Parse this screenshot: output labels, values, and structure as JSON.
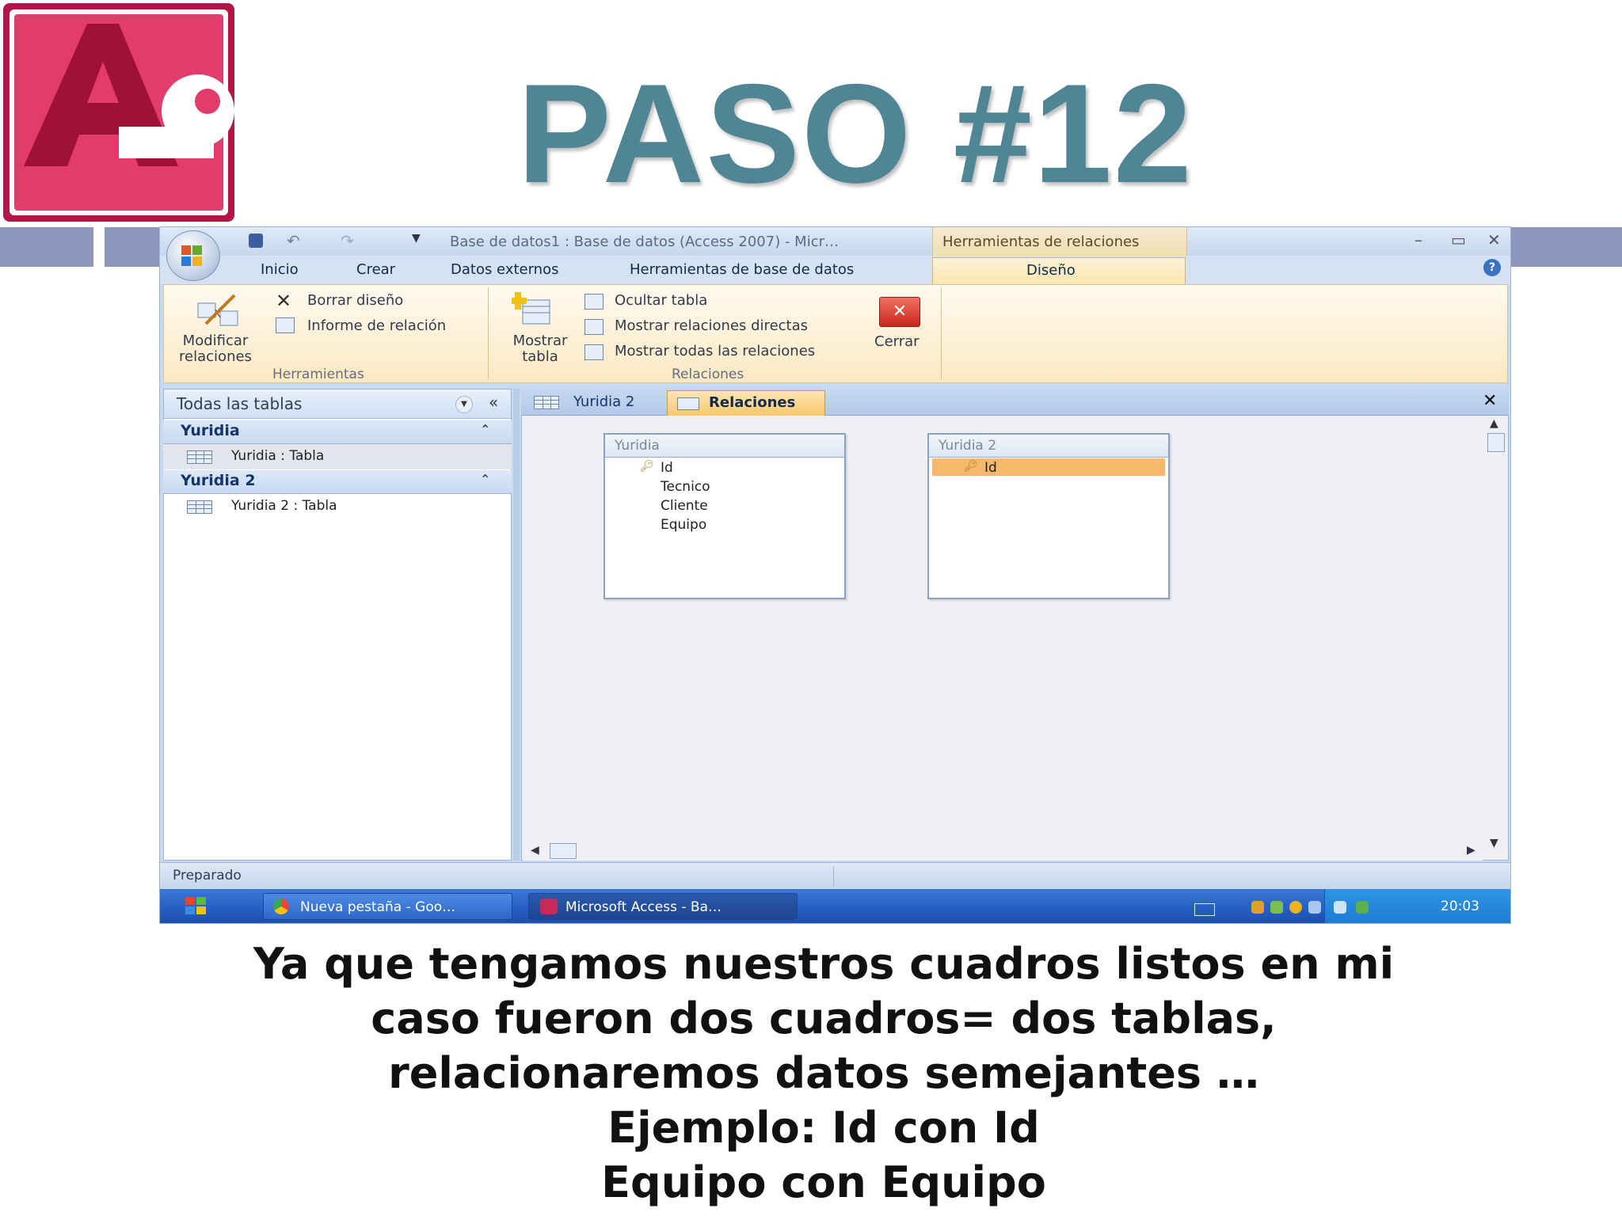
{
  "slide": {
    "title": "PASO #12",
    "caption_lines": [
      "Ya que tengamos nuestros cuadros listos en mi",
      "caso fueron dos cuadros= dos tablas,",
      "relacionaremos datos semejantes …",
      "Ejemplo: Id con Id",
      "Equipo con Equipo"
    ],
    "logo_letter": "A",
    "colors": {
      "title": "#4f8594",
      "band": "#8d97bc",
      "logo": "#a1123c"
    }
  },
  "window": {
    "title": "Base de datos1 : Base de datos (Access 2007) - Micr…",
    "context_title": "Herramientas de relaciones",
    "tabs": [
      "Inicio",
      "Crear",
      "Datos externos",
      "Herramientas de base de datos"
    ],
    "active_tab": "Diseño",
    "controls": {
      "minimize": "–",
      "maximize": "▭",
      "close": "✕",
      "help": "?"
    }
  },
  "ribbon": {
    "herramientas": {
      "label": "Herramientas",
      "modify_line1": "Modificar",
      "modify_line2": "relaciones",
      "clear_layout": "Borrar diseño",
      "report": "Informe de relación"
    },
    "relaciones": {
      "label": "Relaciones",
      "show_table_line1": "Mostrar",
      "show_table_line2": "tabla",
      "hide_table": "Ocultar tabla",
      "direct": "Mostrar relaciones directas",
      "all": "Mostrar todas las relaciones",
      "close": "Cerrar"
    }
  },
  "nav": {
    "header": "Todas las tablas",
    "groups": [
      {
        "name": "Yuridia",
        "items": [
          "Yuridia : Tabla"
        ]
      },
      {
        "name": "Yuridia 2",
        "items": [
          "Yuridia 2 : Tabla"
        ]
      }
    ]
  },
  "doc": {
    "tabs": [
      "Yuridia 2",
      "Relaciones"
    ],
    "active": "Relaciones",
    "tables": [
      {
        "name": "Yuridia",
        "key": "Id",
        "fields": [
          "Tecnico",
          "Cliente",
          "Equipo"
        ]
      },
      {
        "name": "Yuridia 2",
        "key": "Id",
        "fields": []
      }
    ]
  },
  "status": {
    "text": "Preparado"
  },
  "taskbar": {
    "items": [
      "Nueva pestaña - Goo…",
      "Microsoft Access - Ba…"
    ],
    "active": "Microsoft Access - Ba…",
    "clock": "20:03"
  }
}
